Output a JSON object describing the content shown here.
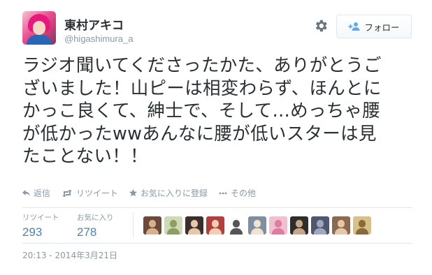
{
  "user": {
    "display_name": "東村アキコ",
    "handle": "@higashimura_a",
    "avatar_icon": "user-avatar"
  },
  "header": {
    "settings_icon": "gear-icon",
    "follow_label": "フォロー",
    "follow_icon": "add-user-icon"
  },
  "tweet": {
    "lines": [
      "ラジオ聞いてくださったかた、ありがとうご",
      "ざいました！山ピーは相変わらず、ほんとに",
      "かっこ良くて、紳士で、そして…めっちゃ腰",
      "が低かったwwあんなに腰が低いスターは見",
      "たことない！！"
    ]
  },
  "actions": {
    "reply": "返信",
    "retweet": "リツイート",
    "favorite": "お気に入りに登録",
    "more": "その他"
  },
  "stats": {
    "retweets_label": "リツイート",
    "retweets_count": "293",
    "favorites_label": "お気に入り",
    "favorites_count": "278"
  },
  "favoriters": [
    {
      "icon": "user-avatar",
      "bg": "#6b4a3a",
      "fg": "#d9b08c"
    },
    {
      "icon": "user-avatar",
      "bg": "#cfd8b8",
      "fg": "#8aa060"
    },
    {
      "icon": "user-avatar",
      "bg": "#3a2f2a",
      "fg": "#e7c7a8"
    },
    {
      "icon": "user-avatar",
      "bg": "#b04040",
      "fg": "#f0d0b0"
    },
    {
      "icon": "user-avatar",
      "bg": "#ffffff",
      "fg": "#555555"
    },
    {
      "icon": "user-avatar",
      "bg": "#7d8fa0",
      "fg": "#f2e2d0"
    },
    {
      "icon": "user-avatar",
      "bg": "#f0c0d0",
      "fg": "#e07aa0"
    },
    {
      "icon": "user-avatar",
      "bg": "#2d2d2d",
      "fg": "#c9a58a"
    },
    {
      "icon": "user-avatar",
      "bg": "#505870",
      "fg": "#a0a8c0"
    },
    {
      "icon": "user-avatar",
      "bg": "#8a6a50",
      "fg": "#e5c8a8"
    },
    {
      "icon": "user-avatar",
      "bg": "#d8c08a",
      "fg": "#8a6a3a"
    }
  ],
  "timestamp": "20:13 - 2014年3月21日",
  "colors": {
    "text": "#292f33",
    "muted": "#8899a6",
    "link": "#4a82b0",
    "border": "#e1e8ed"
  }
}
